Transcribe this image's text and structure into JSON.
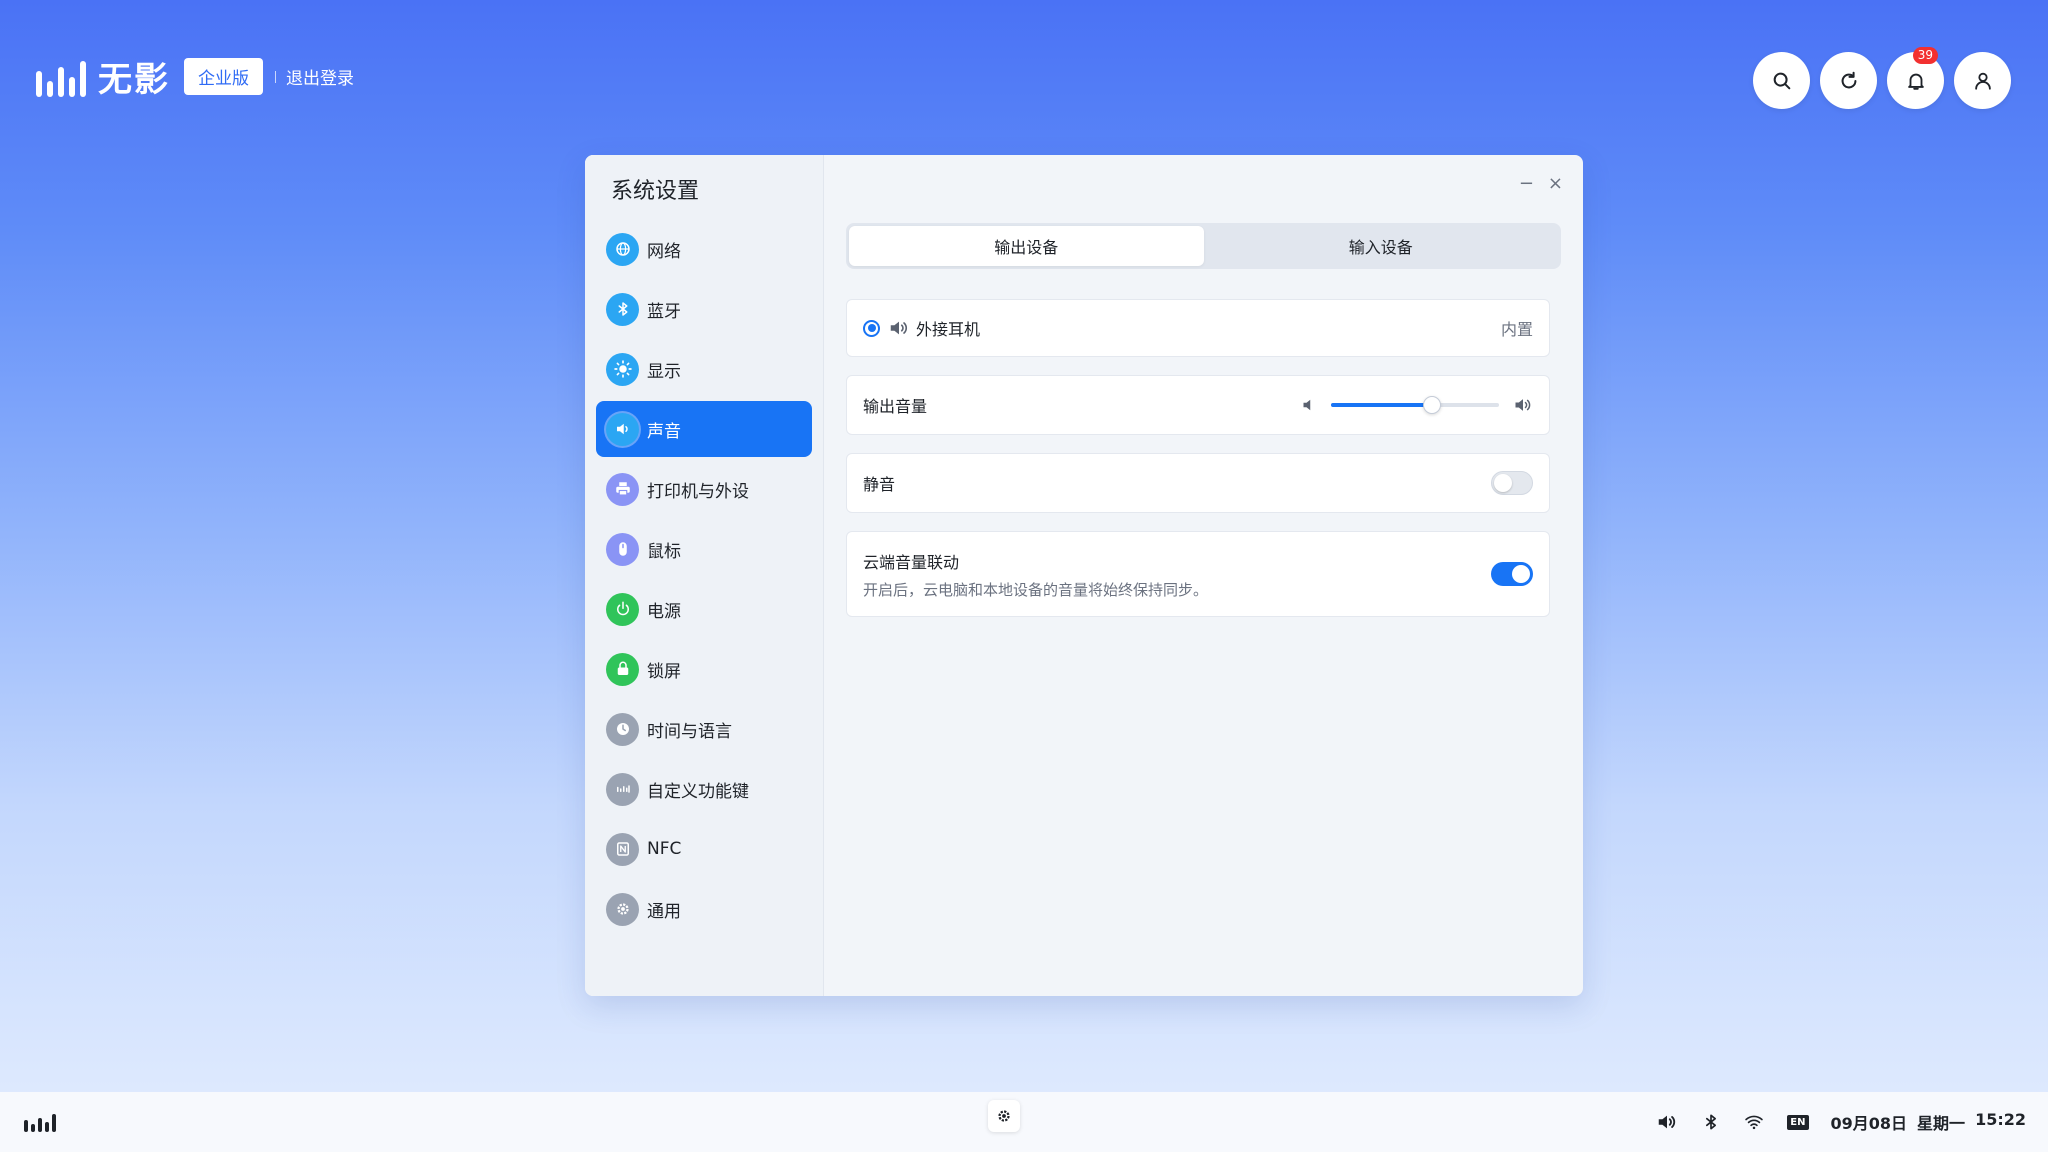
{
  "brand": {
    "name": "无影",
    "edition": "企业版",
    "logout": "退出登录"
  },
  "top_actions": {
    "notification_count": "39"
  },
  "window": {
    "title": "系统设置",
    "minimize": "−",
    "close": "×"
  },
  "sidebar": {
    "items": [
      {
        "label": "网络",
        "icon": "globe-icon",
        "color": "#2ba6f3"
      },
      {
        "label": "蓝牙",
        "icon": "bluetooth-icon",
        "color": "#2ba6f3"
      },
      {
        "label": "显示",
        "icon": "sun-icon",
        "color": "#2ba6f3"
      },
      {
        "label": "声音",
        "icon": "speaker-icon",
        "color": "#2ba6f3",
        "active": true
      },
      {
        "label": "打印机与外设",
        "icon": "printer-icon",
        "color": "#8a94f5"
      },
      {
        "label": "鼠标",
        "icon": "mouse-icon",
        "color": "#8a94f5"
      },
      {
        "label": "电源",
        "icon": "power-icon",
        "color": "#30c45a"
      },
      {
        "label": "锁屏",
        "icon": "lock-icon",
        "color": "#30c45a"
      },
      {
        "label": "时间与语言",
        "icon": "clock-icon",
        "color": "#9aa3b2"
      },
      {
        "label": "自定义功能键",
        "icon": "keys-icon",
        "color": "#9aa3b2"
      },
      {
        "label": "NFC",
        "icon": "nfc-icon",
        "color": "#9aa3b2"
      },
      {
        "label": "通用",
        "icon": "gear-icon",
        "color": "#9aa3b2"
      }
    ]
  },
  "tabs": {
    "output": "输出设备",
    "input": "输入设备"
  },
  "device": {
    "name": "外接耳机",
    "type": "内置"
  },
  "volume": {
    "label": "输出音量",
    "level": 0.6
  },
  "mute": {
    "label": "静音",
    "on": false
  },
  "cloud_sync": {
    "label": "云端音量联动",
    "description": "开启后，云电脑和本地设备的音量将始终保持同步。",
    "on": true
  },
  "taskbar": {
    "date": "09月08日",
    "weekday": "星期一",
    "time": "15:22",
    "lang": "EN"
  },
  "colors": {
    "accent": "#1874f5"
  }
}
